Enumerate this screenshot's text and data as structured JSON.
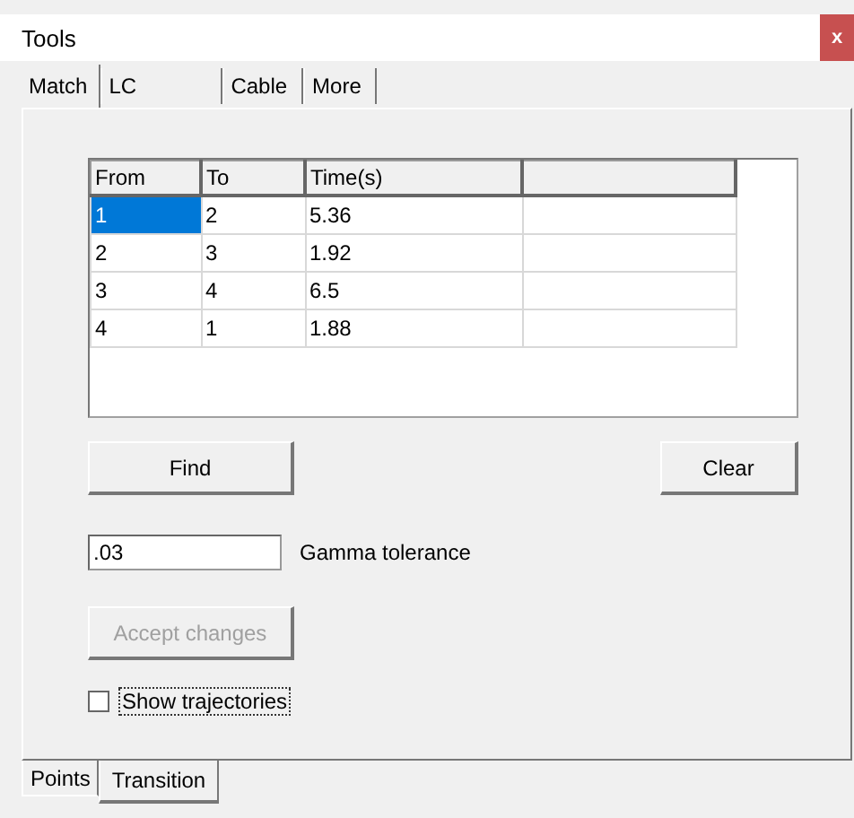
{
  "window": {
    "title": "Tools",
    "close": "x"
  },
  "tabs": [
    {
      "label": "Match",
      "selected": true
    },
    {
      "label": "LC",
      "selected": false
    },
    {
      "label": "Cable",
      "selected": false
    },
    {
      "label": "More",
      "selected": false
    }
  ],
  "table": {
    "columns": [
      "From",
      "To",
      "Time(s)",
      ""
    ],
    "rows": [
      {
        "cells": [
          "1",
          "2",
          "5.36",
          ""
        ],
        "selected": true
      },
      {
        "cells": [
          "2",
          "3",
          "1.92",
          ""
        ],
        "selected": false
      },
      {
        "cells": [
          "3",
          "4",
          "6.5",
          ""
        ],
        "selected": false
      },
      {
        "cells": [
          "4",
          "1",
          "1.88",
          ""
        ],
        "selected": false
      }
    ]
  },
  "find_button": {
    "label": "Find",
    "disabled": false
  },
  "clear_button": {
    "label": "Clear",
    "disabled": false
  },
  "gamma_tolerance": {
    "value": ".03",
    "label": "Gamma tolerance"
  },
  "accept_button": {
    "label": "Accept changes",
    "disabled": true
  },
  "show_trajectories": {
    "label": "Show trajectories",
    "checked": false
  },
  "bottom_tabs": [
    {
      "label": "Points",
      "selected": false
    },
    {
      "label": "Transition",
      "selected": true
    }
  ]
}
